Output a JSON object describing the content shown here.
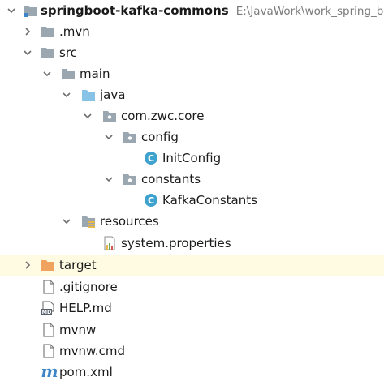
{
  "tree": {
    "root": {
      "label": "springboot-kafka-commons",
      "path": "E:\\JavaWork\\work_spring_bo",
      "icon": "module-folder-icon",
      "expanded": true
    },
    "mvn": {
      "label": ".mvn",
      "icon": "folder-icon",
      "expanded": false
    },
    "src": {
      "label": "src",
      "icon": "folder-icon",
      "expanded": true
    },
    "main": {
      "label": "main",
      "icon": "folder-icon",
      "expanded": true
    },
    "java": {
      "label": "java",
      "icon": "source-root-folder-icon",
      "expanded": true
    },
    "package": {
      "label": "com.zwc.core",
      "icon": "package-icon",
      "expanded": true
    },
    "config": {
      "label": "config",
      "icon": "package-icon",
      "expanded": true
    },
    "initconfig": {
      "label": "InitConfig",
      "icon": "class-icon"
    },
    "constants": {
      "label": "constants",
      "icon": "package-icon",
      "expanded": true
    },
    "kafkaconstants": {
      "label": "KafkaConstants",
      "icon": "class-icon"
    },
    "resources": {
      "label": "resources",
      "icon": "resources-folder-icon",
      "expanded": true
    },
    "properties": {
      "label": "system.properties",
      "icon": "properties-file-icon"
    },
    "target": {
      "label": "target",
      "icon": "excluded-folder-icon",
      "expanded": false
    },
    "gitignore": {
      "label": ".gitignore",
      "icon": "text-file-icon"
    },
    "helpmd": {
      "label": "HELP.md",
      "icon": "markdown-file-icon",
      "icon_text": "MD"
    },
    "mvnw": {
      "label": "mvnw",
      "icon": "text-file-icon"
    },
    "mvnwcmd": {
      "label": "mvnw.cmd",
      "icon": "text-file-icon"
    },
    "pom": {
      "label": "pom.xml",
      "icon": "maven-file-icon",
      "icon_text": "m"
    }
  },
  "colors": {
    "selected_row": "#fffbe3",
    "folder": "#9aa7b0",
    "source_folder": "#87c3e6",
    "excluded_folder": "#f0a25f",
    "class_icon": "#3ea2cf",
    "path_text": "#7a7a7a"
  }
}
